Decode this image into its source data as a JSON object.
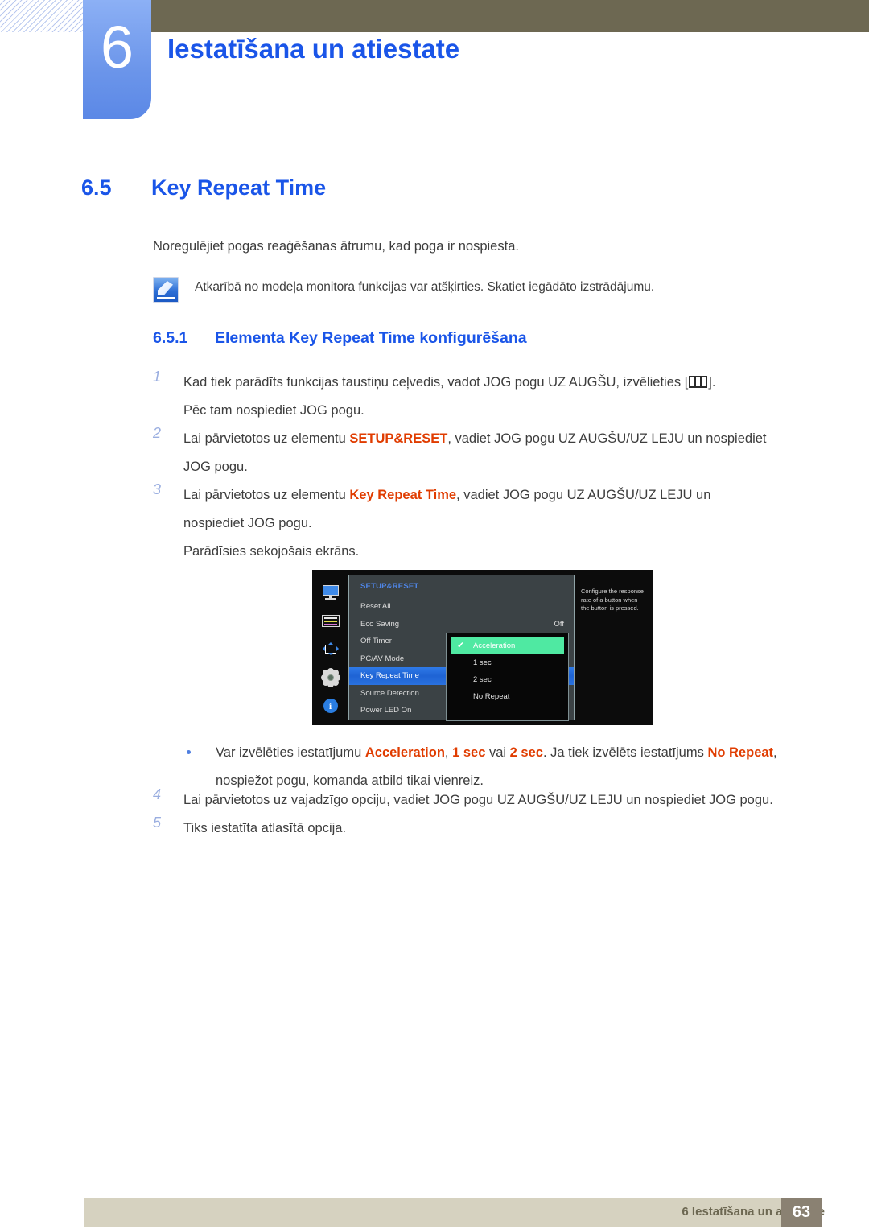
{
  "header": {
    "chapter_number": "6",
    "chapter_title": "Iestatīšana un atiestate",
    "accent_color": "#1a55e8",
    "bar_color": "#6d6852"
  },
  "section": {
    "number": "6.5",
    "title": "Key Repeat Time",
    "intro": "Noregulējiet pogas reaģēšanas ātrumu, kad poga ir nospiesta.",
    "note": "Atkarībā no modeļa monitora funkcijas var atšķirties. Skatiet iegādāto izstrādājumu."
  },
  "subsection": {
    "number": "6.5.1",
    "title": "Elementa Key Repeat Time konfigurēšana"
  },
  "steps": [
    {
      "num": "1",
      "line1_before": "Kad tiek parādīts funkcijas taustiņu ceļvedis, vadot JOG pogu UZ AUGŠU, izvēlieties [",
      "line1_after": "].",
      "line2": "Pēc tam nospiediet JOG pogu."
    },
    {
      "num": "2",
      "line1_before": "Lai pārvietotos uz elementu ",
      "line1_hl": "SETUP&RESET",
      "line1_after": ", vadiet JOG pogu UZ AUGŠU/UZ LEJU un nospiediet",
      "line2": "JOG pogu."
    },
    {
      "num": "3",
      "line1_before": "Lai pārvietotos uz elementu ",
      "line1_hl": "Key Repeat Time",
      "line1_after": ", vadiet JOG pogu UZ AUGŠU/UZ LEJU un",
      "line2": "nospiediet JOG pogu.",
      "line3": "Parādīsies sekojošais ekrāns."
    },
    {
      "num": "4",
      "line1_before": "Lai pārvietotos uz vajadzīgo opciju, vadiet JOG pogu UZ AUGŠU/UZ LEJU un nospiediet JOG pogu."
    },
    {
      "num": "5",
      "line1_before": "Tiks iestatīta atlasītā opcija."
    }
  ],
  "bullet": {
    "t1": "Var izvēlēties iestatījumu ",
    "hl1": "Acceleration",
    "t2": ", ",
    "hl2": "1 sec",
    "t3": " vai ",
    "hl3": "2 sec",
    "t4": ". Ja tiek izvēlēts iestatījums ",
    "hl4": "No Repeat",
    "t5": ",",
    "line2": "nospiežot pogu, komanda atbild tikai vienreiz."
  },
  "osd": {
    "rail_icons": [
      "monitor-icon",
      "color-bars-icon",
      "screen-adjust-icon",
      "gear-icon",
      "info-icon"
    ],
    "title": "SETUP&RESET",
    "menu": [
      {
        "label": "Reset All",
        "value": "",
        "selected": false
      },
      {
        "label": "Eco Saving",
        "value": "Off",
        "selected": false
      },
      {
        "label": "Off Timer",
        "value": "",
        "selected": false
      },
      {
        "label": "PC/AV Mode",
        "value": "",
        "selected": false
      },
      {
        "label": "Key Repeat Time",
        "value": "",
        "selected": true
      },
      {
        "label": "Source Detection",
        "value": "",
        "selected": false
      },
      {
        "label": "Power LED On",
        "value": "",
        "selected": false
      }
    ],
    "submenu": [
      {
        "label": "Acceleration",
        "checked": true
      },
      {
        "label": "1 sec",
        "checked": false
      },
      {
        "label": "2 sec",
        "checked": false
      },
      {
        "label": "No Repeat",
        "checked": false
      }
    ],
    "check_glyph": "✔",
    "help": "Configure the response rate of a button when the button is pressed.",
    "highlight_color": "#2f7ae8",
    "checked_color": "#4fe9a2"
  },
  "footer": {
    "text": "6 Iestatīšana un atiestate",
    "page": "63"
  }
}
